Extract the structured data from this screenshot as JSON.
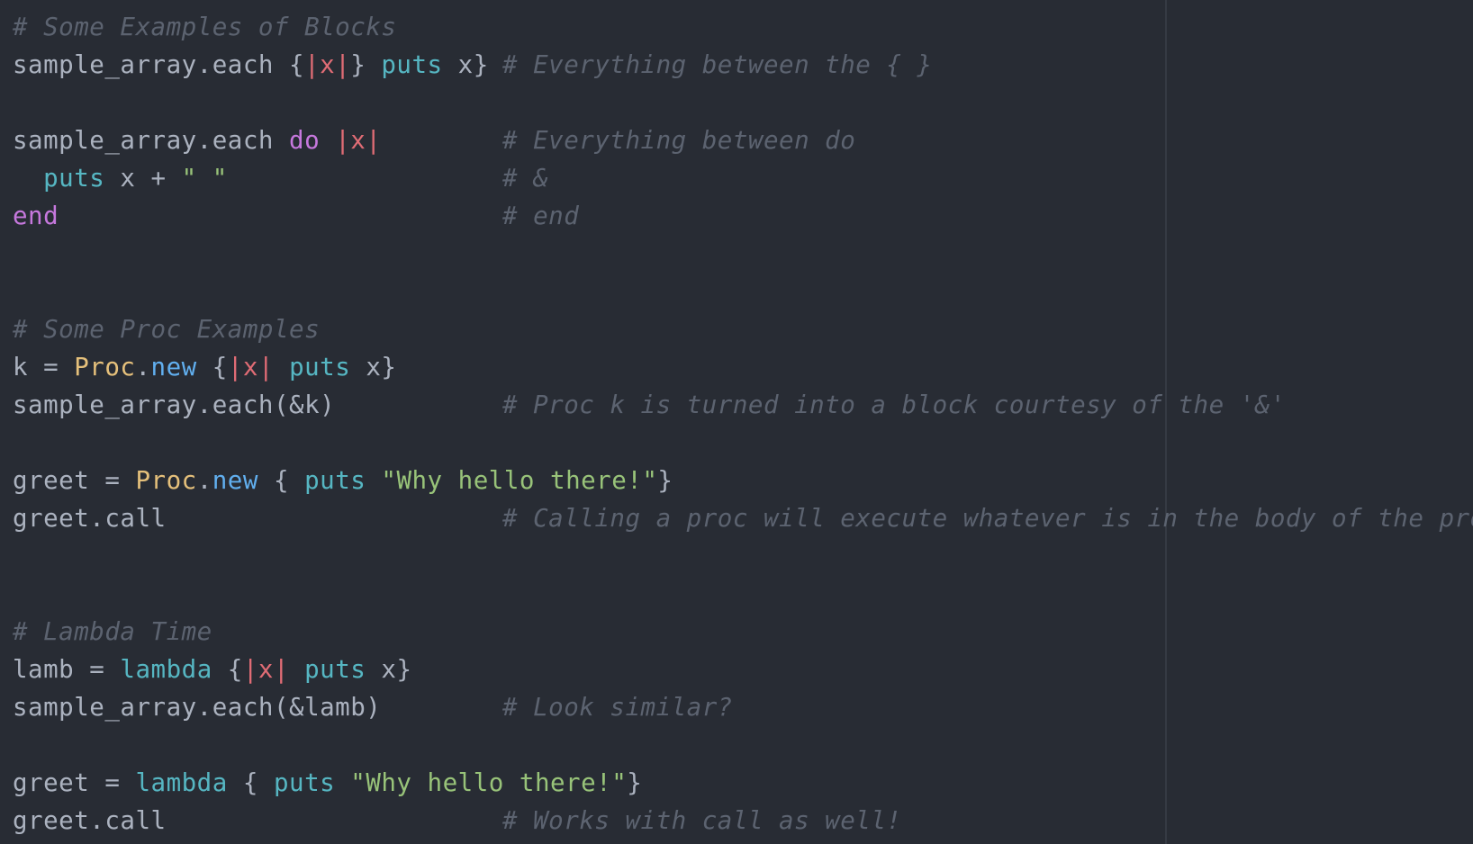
{
  "colors": {
    "background": "#282c34",
    "plain": "#abb2bf",
    "param": "#e06c75",
    "builtin": "#56b6c2",
    "keyword": "#c678dd",
    "string": "#98c379",
    "class": "#e5c07b",
    "method": "#61afef",
    "comment": "#5c6370"
  },
  "lines": [
    {
      "code": [
        [
          "comment",
          "# Some Examples of Blocks"
        ]
      ]
    },
    {
      "code": [
        [
          "plain",
          "sample_array.each {"
        ],
        [
          "param",
          "|x|"
        ],
        [
          "plain",
          "} "
        ],
        [
          "builtin",
          "puts"
        ],
        [
          "plain",
          " x}"
        ]
      ],
      "comment": "# Everything between the { }"
    },
    {
      "code": []
    },
    {
      "code": [
        [
          "plain",
          "sample_array.each "
        ],
        [
          "keyword",
          "do"
        ],
        [
          "plain",
          " "
        ],
        [
          "param",
          "|x|"
        ]
      ],
      "comment": "# Everything between do"
    },
    {
      "code": [
        [
          "plain",
          "  "
        ],
        [
          "builtin",
          "puts"
        ],
        [
          "plain",
          " x + "
        ],
        [
          "string",
          "\" \""
        ]
      ],
      "comment": "# &"
    },
    {
      "code": [
        [
          "keyword",
          "end"
        ]
      ],
      "comment": "# end"
    },
    {
      "code": []
    },
    {
      "code": []
    },
    {
      "code": [
        [
          "comment",
          "# Some Proc Examples"
        ]
      ]
    },
    {
      "code": [
        [
          "plain",
          "k = "
        ],
        [
          "class",
          "Proc"
        ],
        [
          "plain",
          "."
        ],
        [
          "method",
          "new"
        ],
        [
          "plain",
          " {"
        ],
        [
          "param",
          "|x|"
        ],
        [
          "plain",
          " "
        ],
        [
          "builtin",
          "puts"
        ],
        [
          "plain",
          " x}"
        ]
      ]
    },
    {
      "code": [
        [
          "plain",
          "sample_array.each(&k)"
        ]
      ],
      "comment": "# Proc k is turned into a block courtesy of the '&'"
    },
    {
      "code": []
    },
    {
      "code": [
        [
          "plain",
          "greet = "
        ],
        [
          "class",
          "Proc"
        ],
        [
          "plain",
          "."
        ],
        [
          "method",
          "new"
        ],
        [
          "plain",
          " { "
        ],
        [
          "builtin",
          "puts"
        ],
        [
          "plain",
          " "
        ],
        [
          "string",
          "\"Why hello there!\""
        ],
        [
          "plain",
          "}"
        ]
      ]
    },
    {
      "code": [
        [
          "plain",
          "greet.call"
        ]
      ],
      "comment": "# Calling a proc will execute whatever is in the body of the proc"
    },
    {
      "code": []
    },
    {
      "code": []
    },
    {
      "code": [
        [
          "comment",
          "# Lambda Time"
        ]
      ]
    },
    {
      "code": [
        [
          "plain",
          "lamb = "
        ],
        [
          "builtin",
          "lambda"
        ],
        [
          "plain",
          " {"
        ],
        [
          "param",
          "|x|"
        ],
        [
          "plain",
          " "
        ],
        [
          "builtin",
          "puts"
        ],
        [
          "plain",
          " x}"
        ]
      ]
    },
    {
      "code": [
        [
          "plain",
          "sample_array.each(&lamb)"
        ]
      ],
      "comment": "# Look similar?"
    },
    {
      "code": []
    },
    {
      "code": [
        [
          "plain",
          "greet = "
        ],
        [
          "builtin",
          "lambda"
        ],
        [
          "plain",
          " { "
        ],
        [
          "builtin",
          "puts"
        ],
        [
          "plain",
          " "
        ],
        [
          "string",
          "\"Why hello there!\""
        ],
        [
          "plain",
          "}"
        ]
      ]
    },
    {
      "code": [
        [
          "plain",
          "greet.call"
        ]
      ],
      "comment": "# Works with call as well!"
    }
  ]
}
